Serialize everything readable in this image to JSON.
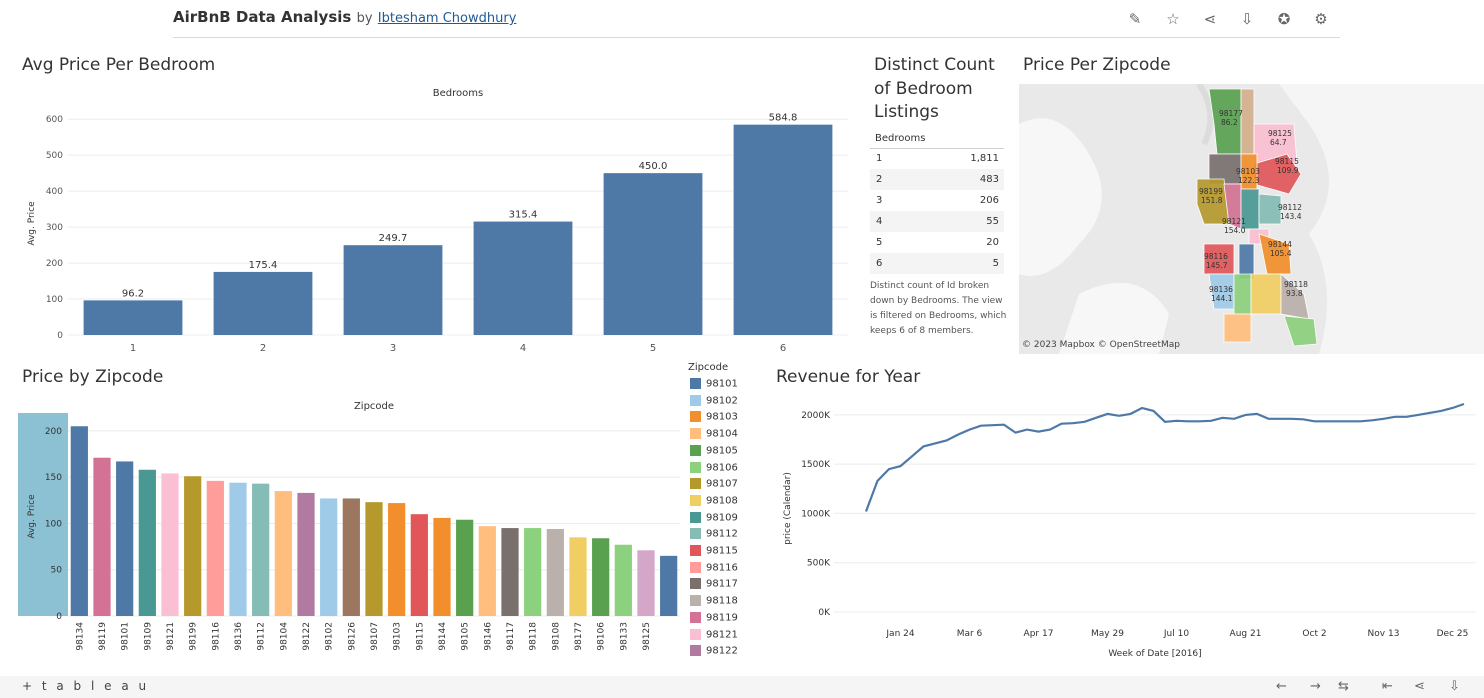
{
  "toolbar": {
    "title": "AirBnB Data Analysis",
    "by": "by",
    "author": "Ibtesham Chowdhury"
  },
  "icons": [
    "edit-icon",
    "star-icon",
    "share-icon",
    "download-icon",
    "award-icon",
    "gear-icon"
  ],
  "colors": {
    "bar_blue": "#4e79a7",
    "highlight_band": "#8cc1d3",
    "line_blue": "#4e79a7"
  },
  "sheets": {
    "bedroom_title": "Avg Price Per Bedroom",
    "table_title": "Distinct Count of Bedroom Listings",
    "map_title": "Price Per Zipcode",
    "zip_title": "Price by Zipcode",
    "revenue_title": "Revenue for Year"
  },
  "table": {
    "header": "Bedrooms",
    "rows": [
      {
        "k": "1",
        "v": "1,811"
      },
      {
        "k": "2",
        "v": "483"
      },
      {
        "k": "3",
        "v": "206"
      },
      {
        "k": "4",
        "v": "55"
      },
      {
        "k": "5",
        "v": "20"
      },
      {
        "k": "6",
        "v": "5"
      }
    ],
    "note": "Distinct count of Id broken down by Bedrooms. The view is filtered on Bedrooms, which keeps 6 of 8 members."
  },
  "map": {
    "credit": "© 2023 Mapbox  © OpenStreetMap",
    "labels": [
      {
        "zip": "98177",
        "val": "86.2"
      },
      {
        "zip": "98125",
        "val": "64.7"
      },
      {
        "zip": "98115",
        "val": "109.9"
      },
      {
        "zip": "98103",
        "val": "122.3"
      },
      {
        "zip": "98199",
        "val": "151.8"
      },
      {
        "zip": "98112",
        "val": "143.4"
      },
      {
        "zip": "98121",
        "val": "154.0"
      },
      {
        "zip": "98144",
        "val": "105.4"
      },
      {
        "zip": "98116",
        "val": "145.7"
      },
      {
        "zip": "98136",
        "val": "144.1"
      },
      {
        "zip": "98118",
        "val": "93.8"
      }
    ]
  },
  "legend": {
    "title": "Zipcode",
    "items": [
      {
        "zip": "98101",
        "color": "#4e79a7"
      },
      {
        "zip": "98102",
        "color": "#a0cbe8"
      },
      {
        "zip": "98103",
        "color": "#f28e2b"
      },
      {
        "zip": "98104",
        "color": "#ffbe7d"
      },
      {
        "zip": "98105",
        "color": "#59a14f"
      },
      {
        "zip": "98106",
        "color": "#8cd17d"
      },
      {
        "zip": "98107",
        "color": "#b6992d"
      },
      {
        "zip": "98108",
        "color": "#f1ce63"
      },
      {
        "zip": "98109",
        "color": "#499894"
      },
      {
        "zip": "98112",
        "color": "#86bcb6"
      },
      {
        "zip": "98115",
        "color": "#e15759"
      },
      {
        "zip": "98116",
        "color": "#ff9d9a"
      },
      {
        "zip": "98117",
        "color": "#79706e"
      },
      {
        "zip": "98118",
        "color": "#bab0ac"
      },
      {
        "zip": "98119",
        "color": "#d37295"
      },
      {
        "zip": "98121",
        "color": "#fabfd2"
      },
      {
        "zip": "98122",
        "color": "#b07aa1"
      }
    ]
  },
  "chart_data": [
    {
      "type": "bar",
      "title": "Avg Price Per Bedroom",
      "header": "Bedrooms",
      "ylabel": "Avg. Price",
      "categories": [
        "1",
        "2",
        "3",
        "4",
        "5",
        "6"
      ],
      "values": [
        96.2,
        175.4,
        249.7,
        315.4,
        450.0,
        584.8
      ],
      "value_labels": [
        "96.2",
        "175.4",
        "249.7",
        "315.4",
        "450.0",
        "584.8"
      ],
      "ylim": [
        0,
        620
      ],
      "yticks": [
        0,
        100,
        200,
        300,
        400,
        500,
        600
      ],
      "color": "#4e79a7",
      "grid": true
    },
    {
      "type": "bar",
      "title": "Price by Zipcode",
      "header": "Zipcode",
      "ylabel": "Avg. Price",
      "categories": [
        "98134",
        "98119",
        "98101",
        "98109",
        "98121",
        "98199",
        "98116",
        "98136",
        "98112",
        "98104",
        "98122",
        "98102",
        "98126",
        "98107",
        "98103",
        "98115",
        "98144",
        "98105",
        "98146",
        "98117",
        "98118",
        "98108",
        "98177",
        "98106",
        "98133",
        "98125"
      ],
      "values": [
        205,
        171,
        167,
        158,
        154,
        151,
        146,
        144,
        143,
        135,
        133,
        127,
        127,
        123,
        122,
        110,
        106,
        104,
        97,
        95,
        95,
        94,
        85,
        84,
        77,
        71,
        65
      ],
      "colors": [
        "#4e79a7",
        "#d37295",
        "#4e79a7",
        "#499894",
        "#fabfd2",
        "#b6992d",
        "#ff9d9a",
        "#a0cbe8",
        "#86bcb6",
        "#ffbe7d",
        "#b07aa1",
        "#a0cbe8",
        "#9d7660",
        "#b6992d",
        "#f28e2b",
        "#e15759",
        "#f28e2b",
        "#59a14f",
        "#ffbe7d",
        "#79706e",
        "#8cd17d",
        "#bab0ac",
        "#f1ce63",
        "#59a14f",
        "#8cd17d",
        "#d4a6c8"
      ],
      "ylim": [
        0,
        215
      ],
      "yticks": [
        0,
        50,
        100,
        150,
        200
      ],
      "grid": true
    },
    {
      "type": "line",
      "title": "Revenue for Year",
      "xlabel": "Week of Date [2016]",
      "ylabel": "price (Calendar)",
      "xticks": [
        "Jan 24",
        "Mar 6",
        "Apr 17",
        "May 29",
        "Jul 10",
        "Aug 21",
        "Oct 2",
        "Nov 13",
        "Dec 25"
      ],
      "yticks": [
        "0K",
        "500K",
        "1000K",
        "1500K",
        "2000K"
      ],
      "ylim": [
        0,
        2100000
      ],
      "x_weeks": [
        0,
        1,
        2,
        3,
        4,
        5,
        6,
        7,
        8,
        9,
        10,
        11,
        12,
        13,
        14,
        15,
        16,
        17,
        18,
        19,
        20,
        21,
        22,
        23,
        24,
        25,
        26,
        27,
        28,
        29,
        30,
        31,
        32,
        33,
        34,
        35,
        36,
        37,
        38,
        39,
        40,
        41,
        42,
        43,
        44,
        45,
        46,
        47,
        48,
        49,
        50,
        51,
        52
      ],
      "y": [
        1020000,
        1330000,
        1450000,
        1480000,
        1580000,
        1680000,
        1710000,
        1740000,
        1800000,
        1850000,
        1890000,
        1895000,
        1900000,
        1820000,
        1850000,
        1830000,
        1850000,
        1910000,
        1915000,
        1930000,
        1970000,
        2010000,
        1990000,
        2010000,
        2070000,
        2040000,
        1930000,
        1940000,
        1935000,
        1935000,
        1940000,
        1970000,
        1960000,
        2000000,
        2010000,
        1960000,
        1960000,
        1960000,
        1955000,
        1935000,
        1935000,
        1935000,
        1935000,
        1935000,
        1945000,
        1960000,
        1980000,
        1980000,
        2000000,
        2020000,
        2040000,
        2070000,
        2110000
      ]
    }
  ],
  "footer": {
    "logo": "+ t a b l e a u"
  }
}
